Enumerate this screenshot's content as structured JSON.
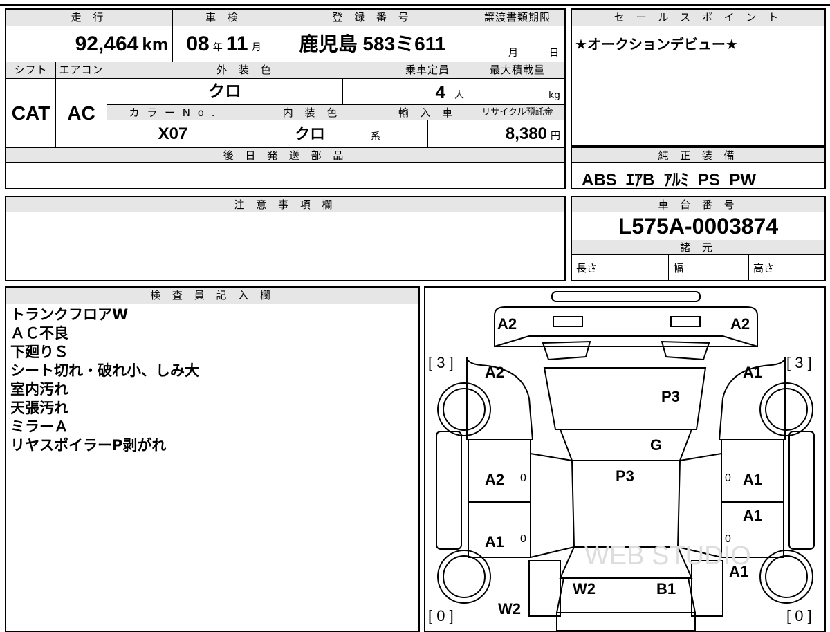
{
  "header": {
    "mileage_label": "走 行",
    "inspection_label": "車 検",
    "registration_label": "登 録 番 号",
    "transfer_deadline_label": "譲渡書類期限",
    "mileage_value": "92,464",
    "mileage_unit": "km",
    "inspection_year": "08",
    "inspection_year_unit": "年",
    "inspection_month": "11",
    "inspection_month_unit": "月",
    "registration_value": "鹿児島 583ミ611",
    "deadline_month_unit": "月",
    "deadline_day_unit": "日"
  },
  "specs": {
    "shift_label": "シフト",
    "aircon_label": "エアコン",
    "exterior_label": "外 装 色",
    "capacity_label": "乗車定員",
    "max_load_label": "最大積載量",
    "shift_value": "CAT",
    "aircon_value": "AC",
    "exterior_value": "クロ",
    "capacity_value": "4",
    "capacity_unit": "人",
    "max_load_unit": "kg",
    "color_no_label": "カ ラ ー N o .",
    "interior_label": "内 装 色",
    "import_label": "輸 入 車",
    "recycle_label": "リサイクル預託金",
    "color_no_value": "X07",
    "interior_value": "クロ",
    "interior_suffix": "系",
    "recycle_value": "8,380",
    "recycle_unit": "円"
  },
  "later_parts": {
    "label": "後 日 発 送 部 品",
    "value": ""
  },
  "notes_section": {
    "label": "注 意 事 項 欄",
    "value": ""
  },
  "sales_point": {
    "label": "セ ー ル ス ポ イ ン ト",
    "value": "★オークションデビュー★"
  },
  "equipment": {
    "label": "純 正 装 備",
    "value": "ABS  ｴｱB  ｱﾙﾐ  PS  PW"
  },
  "chassis": {
    "label": "車 台 番 号",
    "value": "L575A-0003874"
  },
  "dimensions": {
    "label": "諸 元",
    "length_label": "長さ",
    "width_label": "幅",
    "height_label": "高さ"
  },
  "inspector": {
    "label": "検 査 員 記 入 欄",
    "lines": [
      "トランクフロアW",
      "ＡＣ不良",
      "下廻りＳ",
      "シート切れ・破れ小、しみ大",
      "室内汚れ",
      "天張汚れ",
      "ミラーＡ",
      "リヤスポイラーP剥がれ"
    ]
  },
  "diagram": {
    "marks": {
      "front_left": "A2",
      "front_right": "A2",
      "fender_left": "A2",
      "fender_right": "A1",
      "hood": "P3",
      "windshield": "G",
      "roof": "P3",
      "front_door_left": "A2",
      "front_door_right": "A1",
      "rear_door_left": "A1",
      "rear_door_right": "A1",
      "quarter_right": "A1",
      "rear_glass": "W2",
      "trunk": "B1",
      "rear_left_bottom": "W2",
      "tire_fl": "[ 3 ]",
      "tire_fr": "[ 3 ]",
      "tire_rl": "[ 0 ]",
      "tire_rr": "[ 0 ]",
      "zero_1": "0",
      "zero_2": "0",
      "zero_3": "0",
      "zero_4": "0"
    },
    "watermark": "WEB STUDIO"
  }
}
